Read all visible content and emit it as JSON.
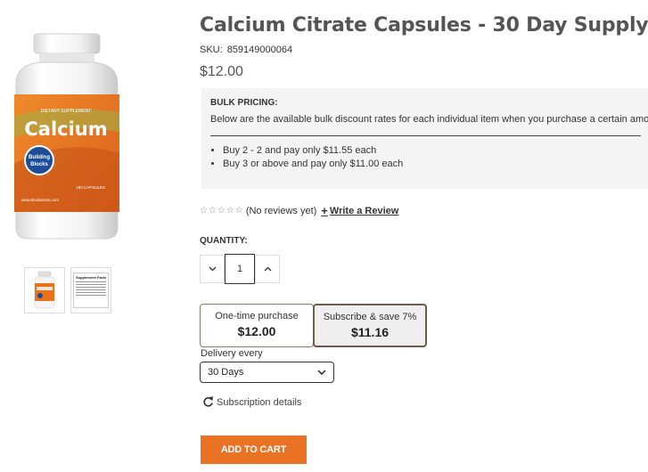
{
  "product": {
    "title": "Calcium Citrate Capsules - 30 Day Supply",
    "sku_label": "SKU:",
    "sku_value": "859149000064",
    "price": "$12.00",
    "image_alt": "Calcium bottle"
  },
  "label": {
    "supplement_tag": "DIETARY SUPPLEMENT",
    "name": "Calcium",
    "brand_line1": "Building",
    "brand_line2": "Blocks",
    "count": "180 CAPSULES",
    "site": "www.bbvitamins.com",
    "thumb_title": "Supplement Facts"
  },
  "bulk": {
    "title": "BULK PRICING:",
    "description": "Below are the available bulk discount rates for each individual item when you purchase a certain amount",
    "tiers": [
      "Buy 2 - 2 and pay only $11.55 each",
      "Buy 3 or above and pay only $11.00 each"
    ]
  },
  "reviews": {
    "stars": "☆☆☆☆☆",
    "text": "(No reviews yet)",
    "write_label": "Write a Review"
  },
  "quantity": {
    "label": "QUANTITY:",
    "value": "1"
  },
  "purchase": {
    "one_time_label": "One-time purchase",
    "one_time_price": "$12.00",
    "subscribe_label": "Subscribe & save 7%",
    "subscribe_price": "$11.16",
    "delivery_label": "Delivery every",
    "delivery_value": "30 Days",
    "details_label": "Subscription details",
    "add_to_cart": "ADD TO CART"
  },
  "colors": {
    "accent": "#ea7225",
    "label_orange": "#e8731c",
    "label_blue": "#1f4c97"
  }
}
